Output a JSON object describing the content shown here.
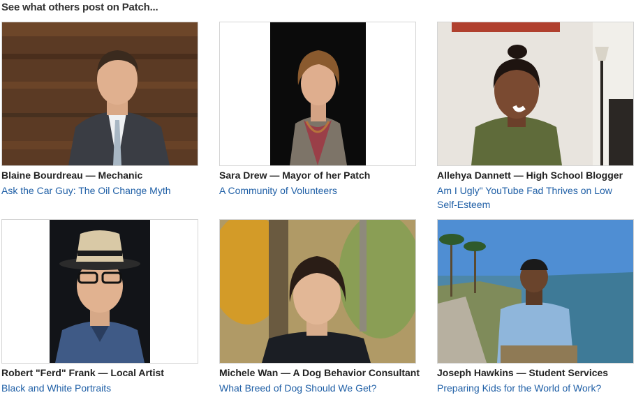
{
  "heading": "See what others post on Patch...",
  "colors": {
    "link": "#1f5fa6",
    "caption": "#222222",
    "frame_border": "#d4d4d4"
  },
  "cards": [
    {
      "caption": "Blaine Bourdreau — Mechanic",
      "link": "Ask the Car Guy: The Oil Change Myth",
      "photo": "man-in-suit-photo"
    },
    {
      "caption": "Sara Drew — Mayor of her Patch",
      "link": "A Community of Volunteers",
      "photo": "woman-black-background-photo"
    },
    {
      "caption": "Allehya Dannett — High School Blogger",
      "link": "Am I Ugly\" YouTube Fad Thrives on Low Self-Esteem",
      "photo": "smiling-girl-photo"
    },
    {
      "caption": "Robert \"Ferd\" Frank — Local Artist",
      "link": "Black and White Portraits",
      "photo": "man-in-fedora-photo"
    },
    {
      "caption": "Michele Wan — A Dog Behavior Consultant",
      "link": "What Breed of Dog Should We Get?",
      "photo": "woman-autumn-trees-photo"
    },
    {
      "caption": "Joseph Hawkins — Student Services",
      "link": "Preparing Kids for the World of Work?",
      "photo": "man-by-seaside-photo"
    }
  ]
}
